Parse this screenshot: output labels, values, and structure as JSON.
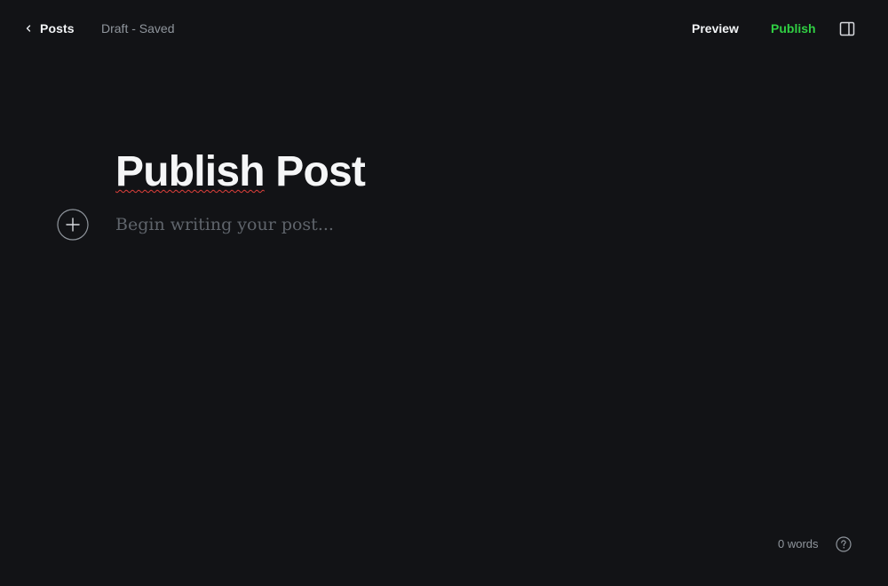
{
  "header": {
    "back_label": "Posts",
    "status": "Draft - Saved",
    "preview_label": "Preview",
    "publish_label": "Publish"
  },
  "editor": {
    "title_word1": "Publish",
    "title_word2": " Post",
    "body_placeholder": "Begin writing your post..."
  },
  "footer": {
    "word_count": "0 words"
  },
  "icons": {
    "back": "chevron-left-icon",
    "sidebar": "sidebar-toggle-icon",
    "add": "plus-circle-icon",
    "help": "question-circle-icon"
  },
  "colors": {
    "background": "#121316",
    "publish_accent": "#30cf43",
    "muted_text": "#8f959c",
    "placeholder_text": "#5f646b"
  }
}
